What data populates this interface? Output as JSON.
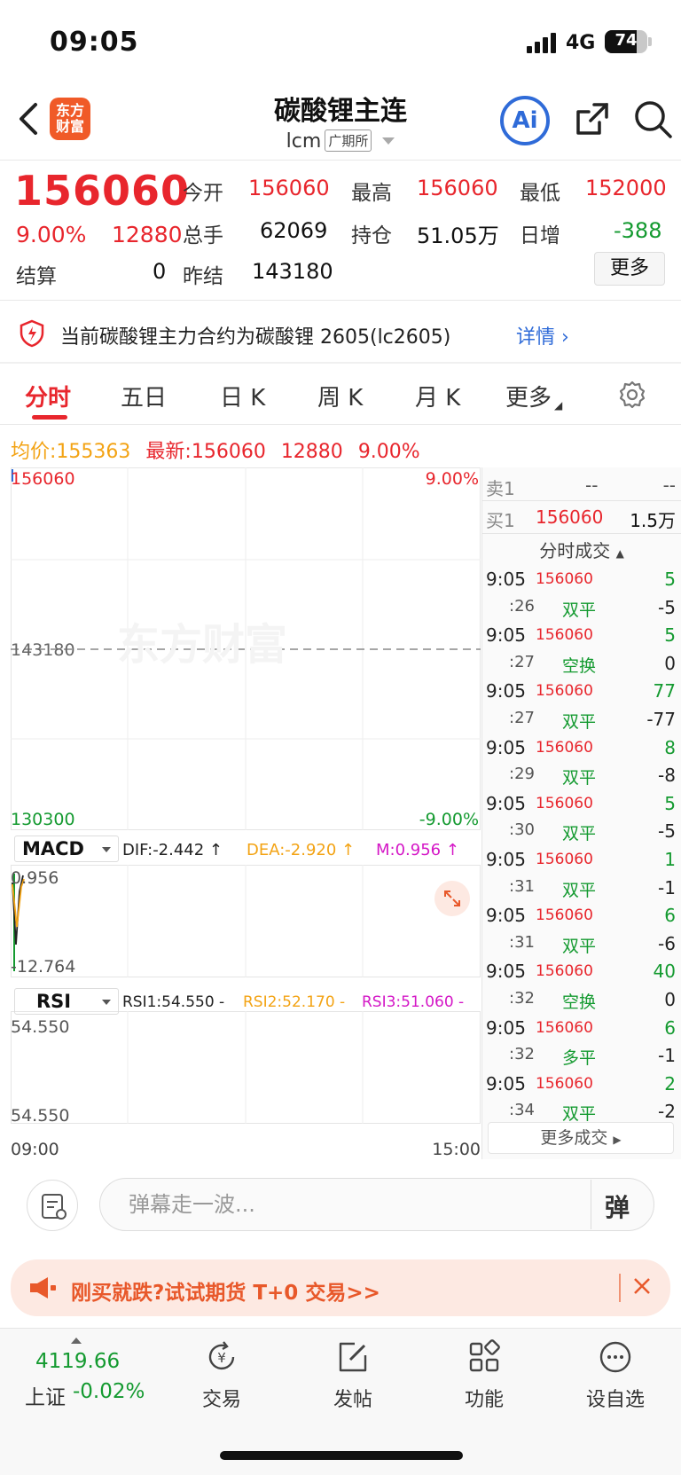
{
  "status_bar": {
    "time": "09:05",
    "network": "4G",
    "battery": "74"
  },
  "header": {
    "logo_line1": "东方",
    "logo_line2": "财富",
    "title": "碳酸锂主连",
    "code": "lcm",
    "exchange": "广期所",
    "ai_label": "Ai"
  },
  "quote": {
    "price": "156060",
    "change_pct": "9.00%",
    "change": "12880",
    "settle_label": "结算",
    "settle_value": "0",
    "fields": [
      {
        "label": "今开",
        "value": "156060",
        "color": "#e8262d"
      },
      {
        "label": "最高",
        "value": "156060",
        "color": "#e8262d"
      },
      {
        "label": "最低",
        "value": "152000",
        "color": "#e8262d"
      },
      {
        "label": "总手",
        "value": "62069",
        "color": "#111111"
      },
      {
        "label": "持仓",
        "value": "51.05万",
        "color": "#111111"
      },
      {
        "label": "日增",
        "value": "-388",
        "color": "#149a30"
      },
      {
        "label": "昨结",
        "value": "143180",
        "color": "#111111"
      }
    ],
    "more_label": "更多"
  },
  "notice": {
    "text": "当前碳酸锂主力合约为碳酸锂 2605(lc2605)",
    "link": "详情"
  },
  "tabs": [
    "分时",
    "五日",
    "日 K",
    "周 K",
    "月 K",
    "更多"
  ],
  "info_line": {
    "avg_label": "均价:",
    "avg_value": "155363",
    "latest_label": "最新:",
    "latest_value": "156060",
    "latest_change": "12880",
    "latest_pct": "9.00%"
  },
  "chart": {
    "top_price": "156060",
    "top_pct": "9.00%",
    "mid_price": "143180",
    "bottom_price": "130300",
    "bottom_pct": "-9.00%",
    "watermark": "东方财富",
    "time_start": "09:00",
    "time_end": "15:00"
  },
  "macd": {
    "name": "MACD",
    "dif": "DIF:-2.442 ↑",
    "dea": "DEA:-2.920 ↑",
    "m": "M:0.956 ↑",
    "top": "0.956",
    "bottom": "-12.764"
  },
  "rsi": {
    "name": "RSI",
    "rsi1": "RSI1:54.550 -",
    "rsi2": "RSI2:52.170 -",
    "rsi3": "RSI3:51.060 -",
    "top": "54.550",
    "bottom": "54.550"
  },
  "order_book": {
    "sell1_label": "卖1",
    "sell1_price": "--",
    "sell1_vol": "--",
    "buy1_label": "买1",
    "buy1_price": "156060",
    "buy1_vol": "1.5万",
    "ticks_title": "分时成交"
  },
  "ticks": [
    {
      "time": "9:05",
      "sec": ":26",
      "price": "156060",
      "vol": "5",
      "type": "双平",
      "oi": "-5"
    },
    {
      "time": "9:05",
      "sec": ":27",
      "price": "156060",
      "vol": "5",
      "type": "空换",
      "oi": "0"
    },
    {
      "time": "9:05",
      "sec": ":27",
      "price": "156060",
      "vol": "77",
      "type": "双平",
      "oi": "-77"
    },
    {
      "time": "9:05",
      "sec": ":29",
      "price": "156060",
      "vol": "8",
      "type": "双平",
      "oi": "-8"
    },
    {
      "time": "9:05",
      "sec": ":30",
      "price": "156060",
      "vol": "5",
      "type": "双平",
      "oi": "-5"
    },
    {
      "time": "9:05",
      "sec": ":31",
      "price": "156060",
      "vol": "1",
      "type": "双平",
      "oi": "-1"
    },
    {
      "time": "9:05",
      "sec": ":31",
      "price": "156060",
      "vol": "6",
      "type": "双平",
      "oi": "-6"
    },
    {
      "time": "9:05",
      "sec": ":32",
      "price": "156060",
      "vol": "40",
      "type": "空换",
      "oi": "0"
    },
    {
      "time": "9:05",
      "sec": ":32",
      "price": "156060",
      "vol": "6",
      "type": "多平",
      "oi": "-1"
    },
    {
      "time": "9:05",
      "sec": ":34",
      "price": "156060",
      "vol": "2",
      "type": "双平",
      "oi": "-2"
    }
  ],
  "more_ticks": "更多成交",
  "danmaku": {
    "placeholder": "弹幕走一波...",
    "send": "弹"
  },
  "promo": {
    "text": "刚买就跌?试试期货 T+0 交易>>"
  },
  "bottom_nav": {
    "index_value": "4119.66",
    "index_name": "上证",
    "index_change": "-0.02%",
    "items": [
      "交易",
      "发帖",
      "功能",
      "设自选"
    ]
  }
}
